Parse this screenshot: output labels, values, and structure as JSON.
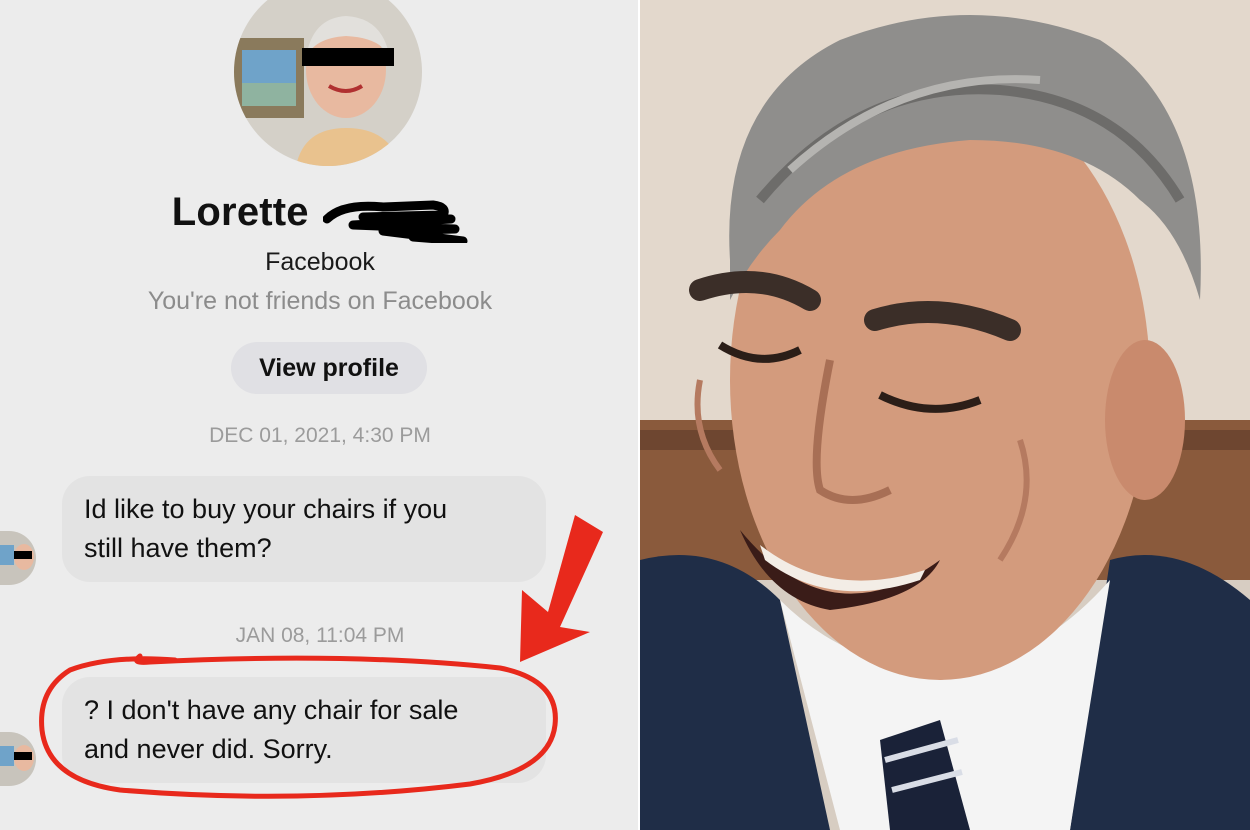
{
  "profile": {
    "name": "Lorette",
    "platform": "Facebook",
    "friend_status": "You're not friends on Facebook",
    "view_profile_label": "View profile"
  },
  "messages": [
    {
      "timestamp": "DEC 01, 2021, 4:30 PM",
      "text_line1": "Id like to buy your chairs if you",
      "text_line2": "still have them?"
    },
    {
      "timestamp": "JAN 08, 11:04 PM",
      "text_line1": "? I don't have any chair for sale",
      "text_line2": "and never did. Sorry."
    }
  ],
  "annotation": {
    "color": "#e8291c"
  },
  "icons": {
    "avatar": "profile-photo",
    "arrow": "red-arrow-icon"
  }
}
